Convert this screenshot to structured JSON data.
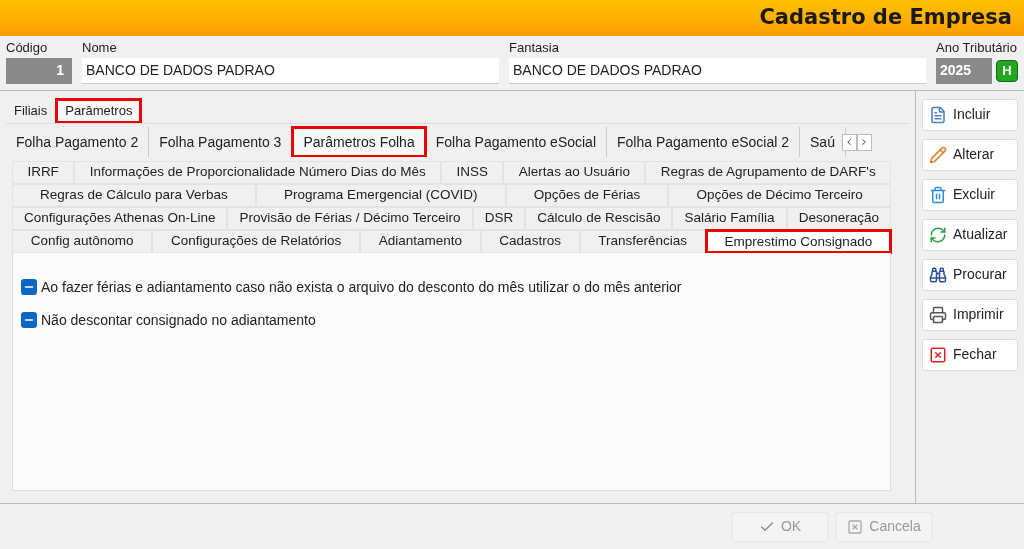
{
  "window": {
    "title": "Cadastro de Empresa"
  },
  "fields": [
    {
      "label": "Código",
      "value": "1",
      "kind": "code"
    },
    {
      "label": "Nome",
      "value": "BANCO DE DADOS PADRAO",
      "kind": "text"
    },
    {
      "label": "Fantasia",
      "value": "BANCO DE DADOS PADRAO",
      "kind": "text"
    },
    {
      "label": "Ano Tributário",
      "value": "2025",
      "kind": "year",
      "button": "H"
    }
  ],
  "main_tabs": [
    {
      "label": "Filiais",
      "selected": false,
      "highlighted": false
    },
    {
      "label": "Parâmetros",
      "selected": true,
      "highlighted": true
    }
  ],
  "sub_tabs": [
    {
      "label": "Folha Pagamento 2",
      "selected": false,
      "highlighted": false
    },
    {
      "label": "Folha Pagamento 3",
      "selected": false,
      "highlighted": false
    },
    {
      "label": "Parâmetros Folha",
      "selected": true,
      "highlighted": true
    },
    {
      "label": "Folha Pagamento eSocial",
      "selected": false,
      "highlighted": false
    },
    {
      "label": "Folha Pagamento eSocial 2",
      "selected": false,
      "highlighted": false
    },
    {
      "label": "Saú",
      "selected": false,
      "highlighted": false
    }
  ],
  "param_tab_rows": [
    [
      {
        "label": "IRRF",
        "selected": false,
        "highlighted": false
      },
      {
        "label": "Informações de Proporcionalidade Número Dias do Mês",
        "selected": false,
        "highlighted": false
      },
      {
        "label": "INSS",
        "selected": false,
        "highlighted": false
      },
      {
        "label": "Alertas ao Usuário",
        "selected": false,
        "highlighted": false
      },
      {
        "label": "Regras de Agrupamento de DARF's",
        "selected": false,
        "highlighted": false
      }
    ],
    [
      {
        "label": "Regras de Cálculo para Verbas",
        "selected": false,
        "highlighted": false
      },
      {
        "label": "Programa Emergencial (COVID)",
        "selected": false,
        "highlighted": false
      },
      {
        "label": "Opções de Férias",
        "selected": false,
        "highlighted": false
      },
      {
        "label": "Opções de Décimo Terceiro",
        "selected": false,
        "highlighted": false
      }
    ],
    [
      {
        "label": "Configurações Athenas On-Line",
        "selected": false,
        "highlighted": false
      },
      {
        "label": "Provisão de Férias / Décimo Terceiro",
        "selected": false,
        "highlighted": false
      },
      {
        "label": "DSR",
        "selected": false,
        "highlighted": false
      },
      {
        "label": "Cálculo de Rescisão",
        "selected": false,
        "highlighted": false
      },
      {
        "label": "Salário Família",
        "selected": false,
        "highlighted": false
      },
      {
        "label": "Desoneração",
        "selected": false,
        "highlighted": false
      }
    ],
    [
      {
        "label": "Config autônomo",
        "selected": false,
        "highlighted": false
      },
      {
        "label": "Configurações de Relatórios",
        "selected": false,
        "highlighted": false
      },
      {
        "label": "Adiantamento",
        "selected": false,
        "highlighted": false
      },
      {
        "label": "Cadastros",
        "selected": false,
        "highlighted": false
      },
      {
        "label": "Transferências",
        "selected": false,
        "highlighted": false
      },
      {
        "label": "Emprestimo Consignado",
        "selected": true,
        "highlighted": true
      }
    ]
  ],
  "options": [
    {
      "label": "Ao fazer férias e adiantamento caso não exista o arquivo do desconto do mês utilizar o do mês anterior",
      "indeterminate": true
    },
    {
      "label": "Não descontar consignado no adiantamento",
      "indeterminate": true
    }
  ],
  "side_buttons": [
    {
      "label": "Incluir",
      "kind": "new"
    },
    {
      "label": "Alterar",
      "kind": "edit"
    },
    {
      "label": "Excluir",
      "kind": "delete"
    },
    {
      "label": "Atualizar",
      "kind": "refresh"
    },
    {
      "label": "Procurar",
      "kind": "search"
    },
    {
      "label": "Imprimir",
      "kind": "print"
    },
    {
      "label": "Fechar",
      "kind": "close"
    }
  ],
  "footer_buttons": [
    {
      "label": "OK",
      "kind": "ok",
      "disabled": true
    },
    {
      "label": "Cancela",
      "kind": "cancel",
      "disabled": true
    }
  ]
}
